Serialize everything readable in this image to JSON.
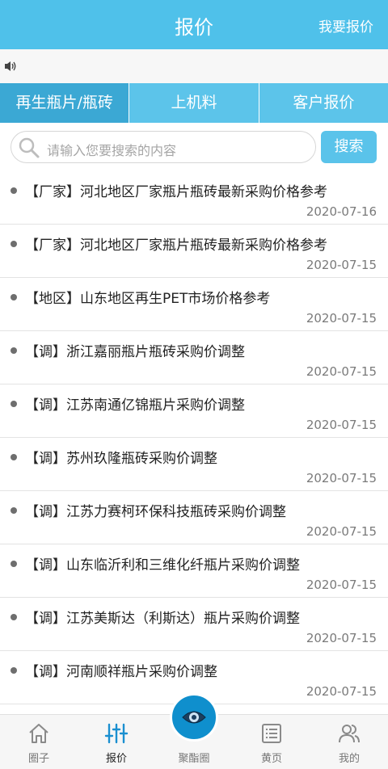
{
  "header": {
    "title": "报价",
    "action_label": "我要报价"
  },
  "notice": {
    "icon": "speaker-icon"
  },
  "tabs": [
    {
      "label": "再生瓶片/瓶砖",
      "active": true
    },
    {
      "label": "上机料",
      "active": false
    },
    {
      "label": "客户报价",
      "active": false
    }
  ],
  "search": {
    "placeholder": "请输入您要搜索的内容",
    "button_label": "搜索",
    "icon": "search-icon"
  },
  "items": [
    {
      "title": "【厂家】河北地区厂家瓶片瓶砖最新采购价格参考",
      "date": "2020-07-16"
    },
    {
      "title": "【厂家】河北地区厂家瓶片瓶砖最新采购价格参考",
      "date": "2020-07-15"
    },
    {
      "title": "【地区】山东地区再生PET市场价格参考",
      "date": "2020-07-15"
    },
    {
      "title": "【调】浙江嘉丽瓶片瓶砖采购价调整",
      "date": "2020-07-15"
    },
    {
      "title": "【调】江苏南通亿锦瓶片采购价调整",
      "date": "2020-07-15"
    },
    {
      "title": "【调】苏州玖隆瓶砖采购价调整",
      "date": "2020-07-15"
    },
    {
      "title": "【调】江苏力赛柯环保科技瓶砖采购价调整",
      "date": "2020-07-15"
    },
    {
      "title": "【调】山东临沂利和三维化纤瓶片采购价调整",
      "date": "2020-07-15"
    },
    {
      "title": "【调】江苏美斯达（利斯达）瓶片采购价调整",
      "date": "2020-07-15"
    },
    {
      "title": "【调】河南顺祥瓶片采购价调整",
      "date": "2020-07-15"
    }
  ],
  "bottom_nav": [
    {
      "label": "圈子",
      "icon": "home-icon",
      "active": false
    },
    {
      "label": "报价",
      "icon": "sliders-icon",
      "active": true
    },
    {
      "label": "聚酯圈",
      "icon": "eye-icon",
      "active": false
    },
    {
      "label": "黄页",
      "icon": "list-icon",
      "active": false
    },
    {
      "label": "我的",
      "icon": "users-icon",
      "active": false
    }
  ],
  "colors": {
    "accent": "#4fc1ea",
    "active_tab": "#3ba8d4",
    "center_button": "#0f8fcd"
  }
}
